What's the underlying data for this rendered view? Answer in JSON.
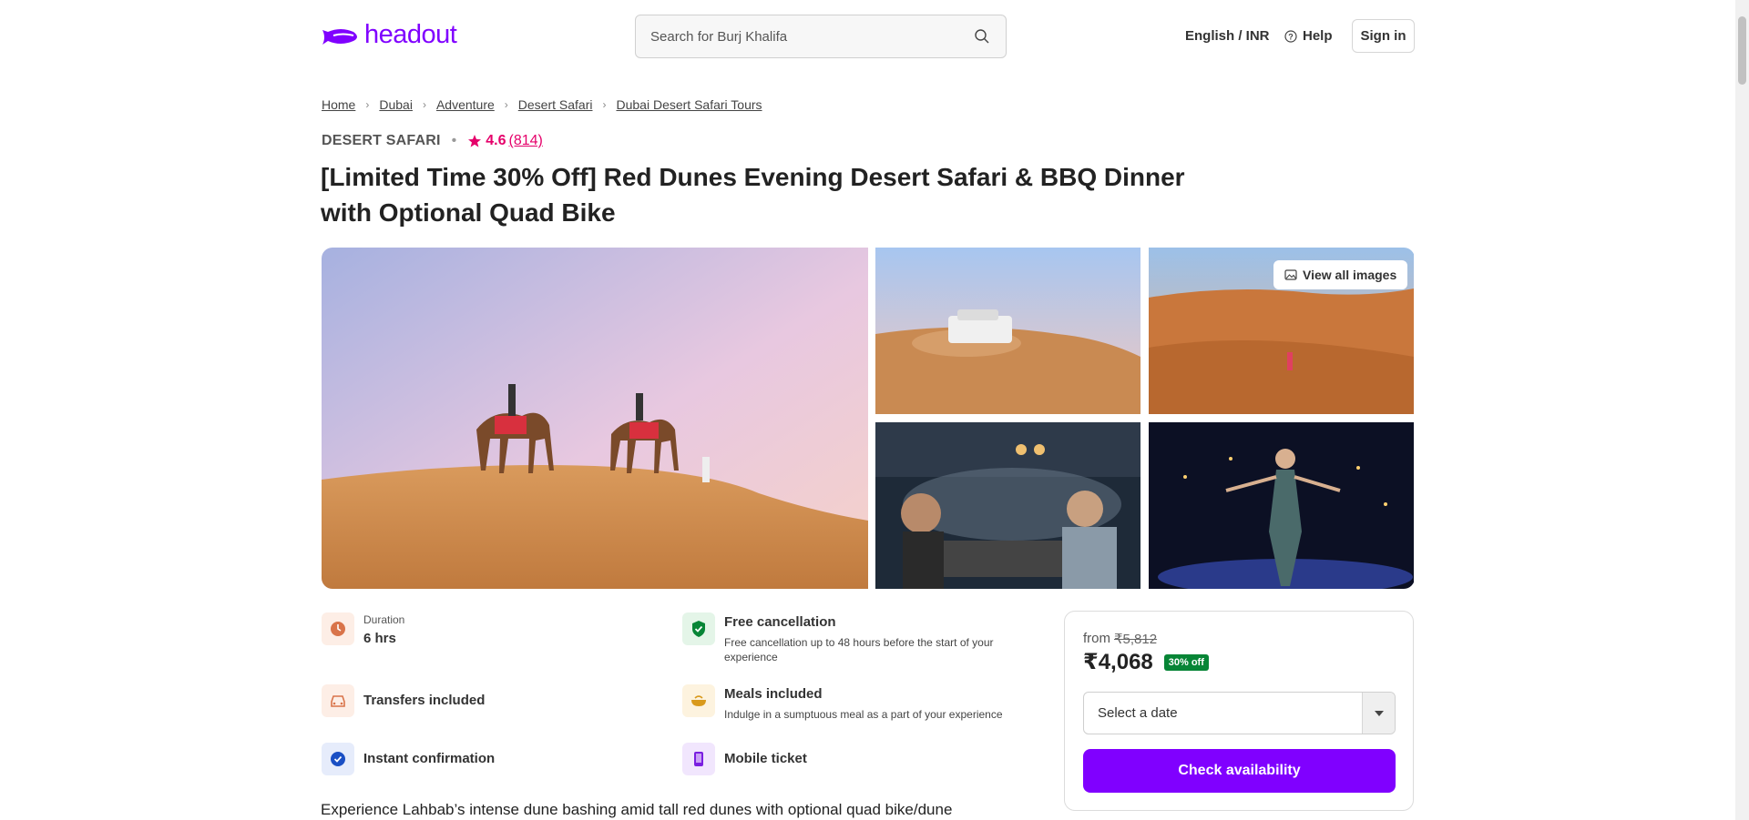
{
  "header": {
    "logo_text": "headout",
    "search_placeholder": "Search for Burj Khalifa",
    "language_currency": "English / INR",
    "help_label": "Help",
    "signin_label": "Sign in"
  },
  "breadcrumb": [
    {
      "label": "Home"
    },
    {
      "label": "Dubai"
    },
    {
      "label": "Adventure"
    },
    {
      "label": "Desert Safari"
    },
    {
      "label": "Dubai Desert Safari Tours"
    }
  ],
  "product": {
    "category": "DESERT SAFARI",
    "rating": "4.6",
    "review_count": "(814)",
    "title": "[Limited Time 30% Off] Red Dunes Evening Desert Safari & BBQ Dinner with Optional Quad Bike",
    "view_all_images": "View all images",
    "description_start": "Experience Lahbab’s intense dune bashing amid tall red dunes with optional quad bike/dune"
  },
  "features": {
    "duration_label": "Duration",
    "duration_value": "6 hrs",
    "free_cancellation_title": "Free cancellation",
    "free_cancellation_desc": "Free cancellation up to 48 hours before the start of your experience",
    "transfers": "Transfers included",
    "meals_title": "Meals included",
    "meals_desc": "Indulge in a sumptuous meal as a part of your experience",
    "instant_confirmation": "Instant confirmation",
    "mobile_ticket": "Mobile ticket"
  },
  "booking": {
    "from_label": "from",
    "original_price": "₹5,812",
    "price": "₹4,068",
    "discount_badge": "30% off",
    "date_placeholder": "Select a date",
    "check_button": "Check availability"
  },
  "colors": {
    "brand": "#8000ff",
    "rating": "#e5006a",
    "discount": "#078536"
  }
}
